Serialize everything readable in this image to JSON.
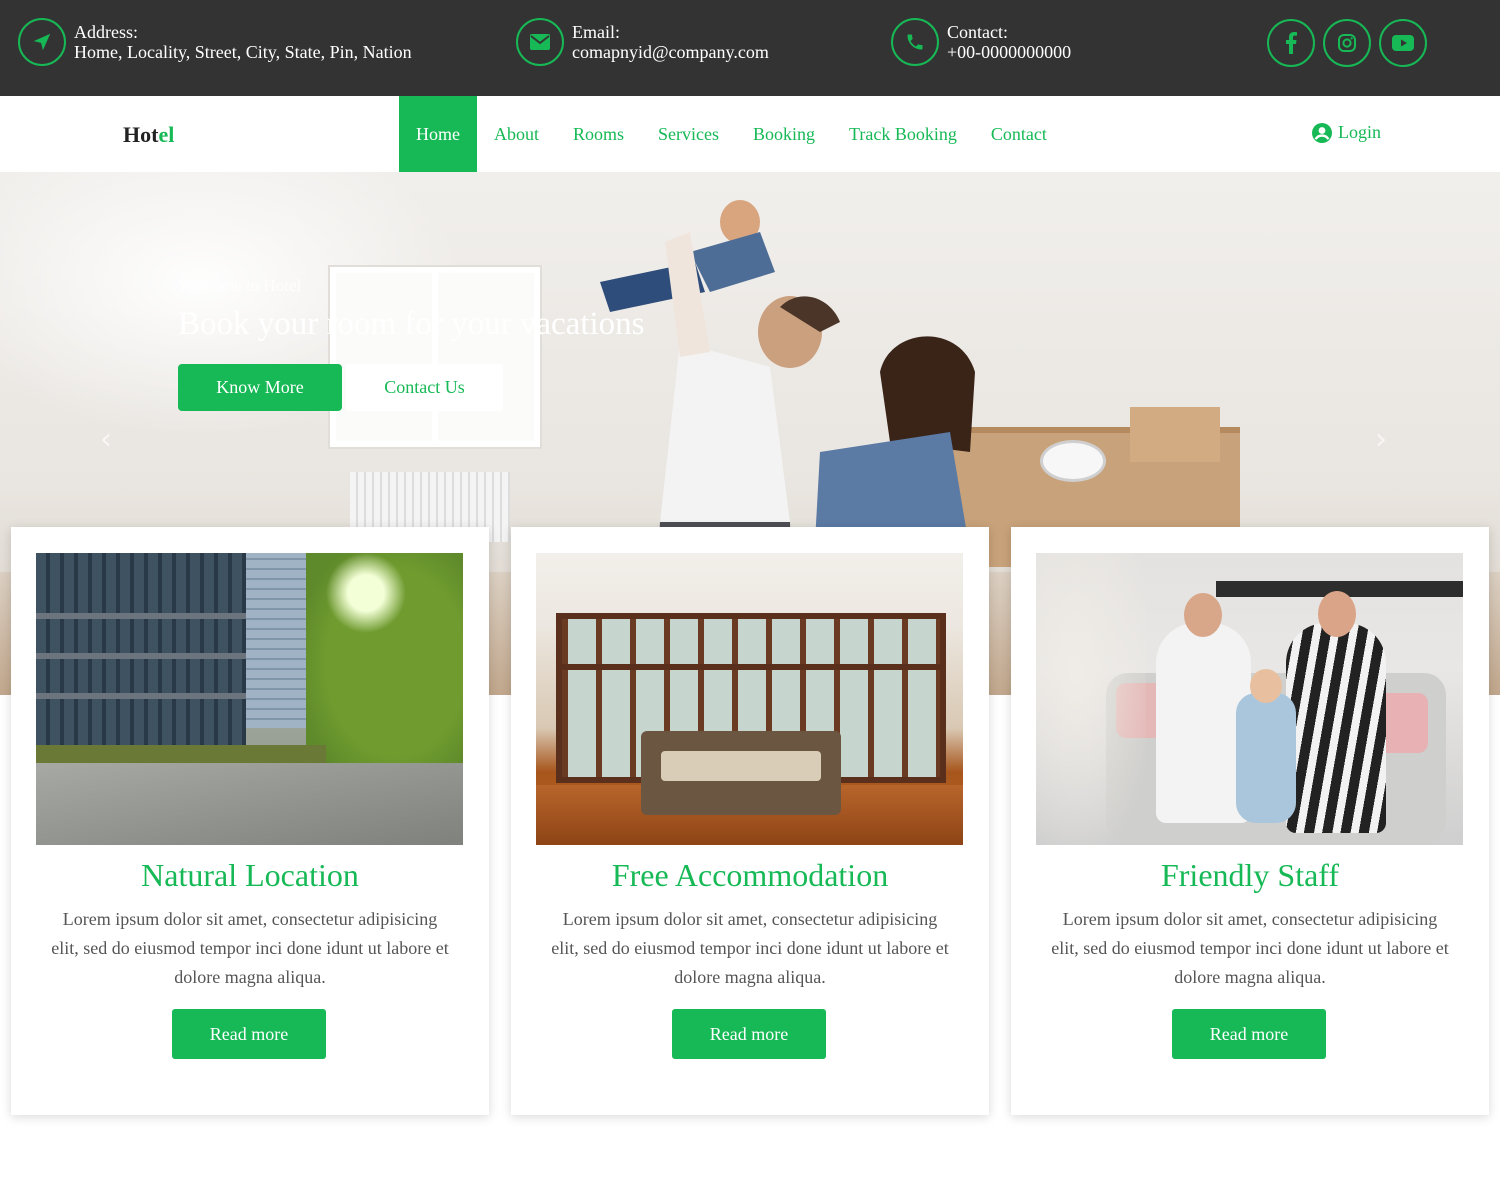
{
  "colors": {
    "accent": "#16b955",
    "topbar": "#333333",
    "white": "#ffffff"
  },
  "topbar": {
    "address": {
      "icon": "location-arrow-icon",
      "label": "Address:",
      "value": "Home, Locality, Street, City, State, Pin, Nation"
    },
    "email": {
      "icon": "envelope-icon",
      "label": "Email:",
      "value": "comapnyid@company.com"
    },
    "contact": {
      "icon": "phone-icon",
      "label": "Contact:",
      "value": "+00-0000000000"
    },
    "social": [
      "facebook-icon",
      "instagram-icon",
      "youtube-icon"
    ]
  },
  "nav": {
    "brand_prefix": "Hot",
    "brand_accent": "el",
    "items": [
      "Home",
      "About",
      "Rooms",
      "Services",
      "Booking",
      "Track Booking",
      "Contact"
    ],
    "active": "Home",
    "login": "Login"
  },
  "hero": {
    "subtitle": "Welcome to Hotel",
    "title": "Book your room for your vacations",
    "btn_primary": "Know More",
    "btn_secondary": "Contact Us",
    "prev_icon": "‹",
    "next_icon": "›"
  },
  "cards": [
    {
      "title": "Natural Location",
      "text": "Lorem ipsum dolor sit amet, consectetur adipisicing elit, sed do eiusmod tempor inci done idunt ut labore et dolore magna aliqua.",
      "button": "Read more"
    },
    {
      "title": "Free Accommodation",
      "text": "Lorem ipsum dolor sit amet, consectetur adipisicing elit, sed do eiusmod tempor inci done idunt ut labore et dolore magna aliqua.",
      "button": "Read more"
    },
    {
      "title": "Friendly Staff",
      "text": "Lorem ipsum dolor sit amet, consectetur adipisicing elit, sed do eiusmod tempor inci done idunt ut labore et dolore magna aliqua.",
      "button": "Read more"
    }
  ]
}
